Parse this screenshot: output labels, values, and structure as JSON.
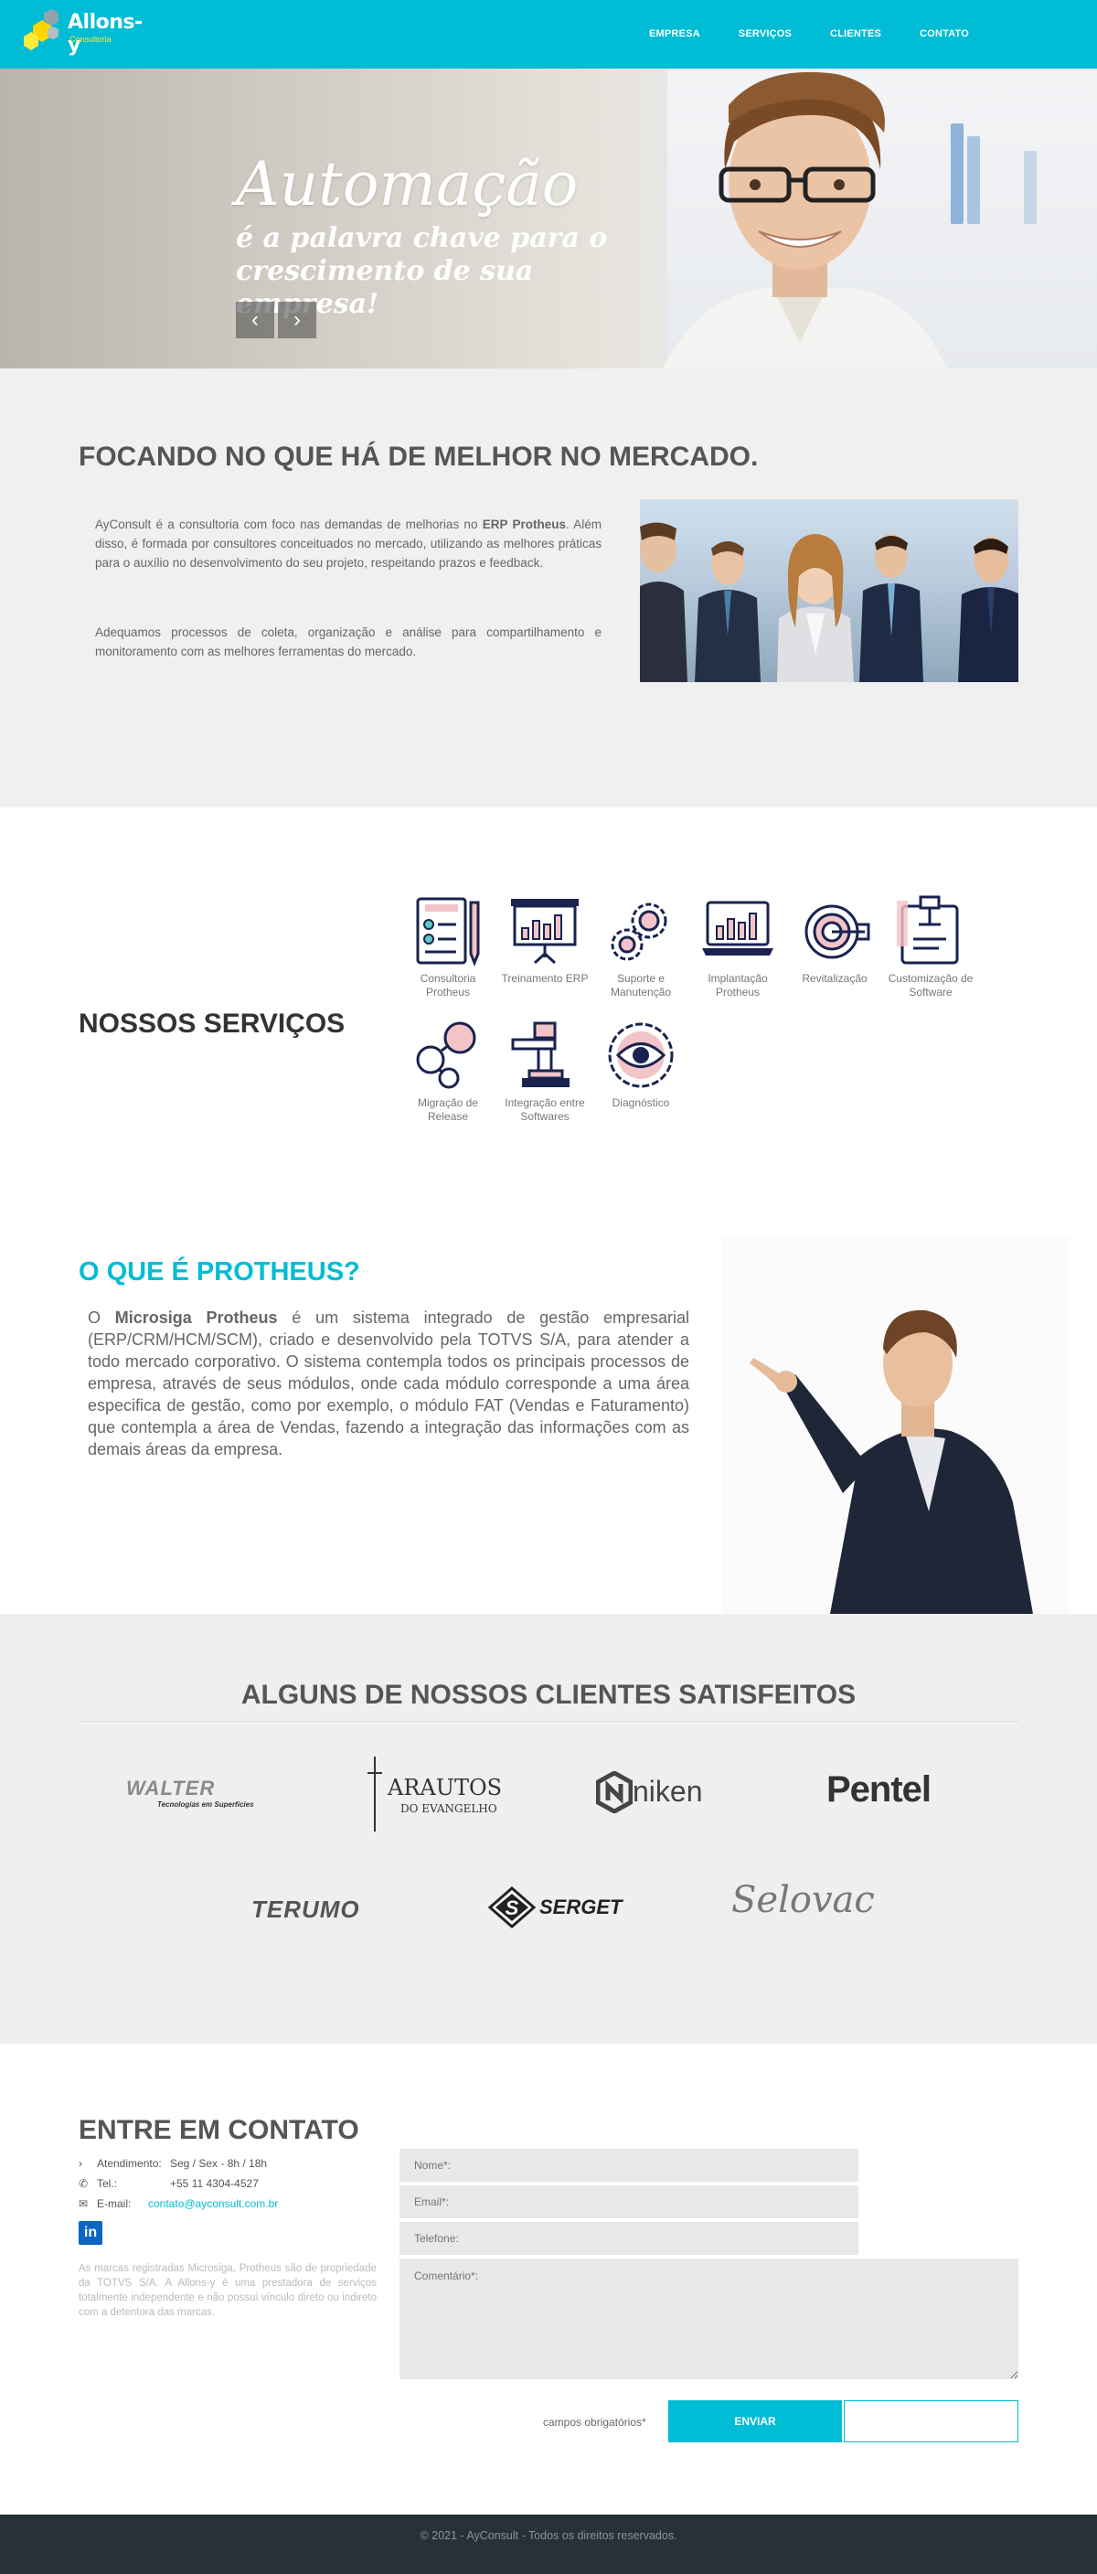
{
  "header": {
    "logo_text": "Allons-y",
    "logo_sub": "Consultoria",
    "nav": [
      "EMPRESA",
      "SERVIÇOS",
      "CLIENTES",
      "CONTATO"
    ]
  },
  "hero": {
    "title": "Automação",
    "subtitle": "é a palavra chave para o crescimento de sua empresa!",
    "prev_icon": "‹",
    "next_icon": "›"
  },
  "about": {
    "title": "FOCANDO NO QUE HÁ DE MELHOR NO MERCADO.",
    "p1_before": "AyConsult é a consultoria com foco nas demandas de melhorias no ",
    "p1_bold": "ERP Protheus",
    "p1_after": ". Além disso, é formada por consultores conceituados no mercado, utilizando as melhores práticas para o auxílio no desenvolvimento do seu projeto, respeitando prazos e feedback.",
    "p2": "Adequamos processos de coleta, organização e análise para compartilhamento e monitoramento com as melhores ferramentas do mercado."
  },
  "services": {
    "title": "NOSSOS SERVIÇOS",
    "items": [
      {
        "label": "Consultoria Protheus",
        "icon": "checklist-icon"
      },
      {
        "label": "Treinamento ERP",
        "icon": "presentation-icon"
      },
      {
        "label": "Suporte e Manutenção",
        "icon": "gears-icon"
      },
      {
        "label": "Implantação Protheus",
        "icon": "laptop-chart-icon"
      },
      {
        "label": "Revitalização",
        "icon": "target-icon"
      },
      {
        "label": "Customização de Software",
        "icon": "clipboard-icon"
      },
      {
        "label": "Migração de Release",
        "icon": "migration-icon"
      },
      {
        "label": "Integração entre Softwares",
        "icon": "integration-icon"
      },
      {
        "label": "Diagnóstico",
        "icon": "eye-gear-icon"
      }
    ]
  },
  "protheus": {
    "title": "O QUE É PROTHEUS?",
    "text_before": "O ",
    "text_bold": "Microsiga Protheus",
    "text_after": " é um sistema integrado de gestão empresarial (ERP/CRM/HCM/SCM), criado e desenvolvido pela TOTVS S/A, para atender a todo mercado corporativo. O sistema contempla todos os principais processos de empresa, através de seus módulos, onde cada módulo corresponde a uma área especifica de gestão, como por exemplo, o módulo FAT (Vendas e Faturamento) que contempla a área de Vendas, fazendo a integração das informações com as demais áreas da empresa."
  },
  "clients": {
    "title": "ALGUNS DE NOSSOS CLIENTES SATISFEITOS",
    "logos": [
      {
        "name": "WALTER",
        "tagline": "Tecnologias em Superfícies"
      },
      {
        "name": "ARAUTOS",
        "tagline": "DO EVANGELHO"
      },
      {
        "name": "niken",
        "tagline": ""
      },
      {
        "name": "Pentel",
        "tagline": ""
      },
      {
        "name": "TERUMO",
        "tagline": ""
      },
      {
        "name": "SERGET",
        "tagline": ""
      },
      {
        "name": "Selovac",
        "tagline": ""
      }
    ]
  },
  "contact": {
    "title": "ENTRE EM CONTATO",
    "attendance_label": "Atendimento:",
    "attendance_value": "Seg / Sex - 8h / 18h",
    "phone_label": "Tel.:",
    "phone_value": "+55 11 4304-4527",
    "email_label": "E-mail:",
    "email_value": "contato@ayconsult.com.br",
    "linkedin": "in",
    "disclaimer": "As marcas registradas Microsiga, Protheus são de propriedade da TOTVS S/A. A Allons-y é uma prestadora de serviços totalmente independente e não possui vínculo direto ou indireto com a detentora das marcas.",
    "name_placeholder": "Nome*:",
    "email_placeholder": "Email*:",
    "phone_placeholder": "Telefone:",
    "comment_placeholder": "Comentário*:",
    "required_note": "campos obrigatórios*",
    "send_label": "ENVIAR"
  },
  "footer": {
    "text": "© 2021 - AyConsult - Todos os direitos reservados."
  },
  "colors": {
    "accent": "#00bcd4",
    "footer_bg": "#263238",
    "section_grey": "#f0f0f0",
    "icon_navy": "#1a2350",
    "icon_pink": "#f2c4c8"
  }
}
